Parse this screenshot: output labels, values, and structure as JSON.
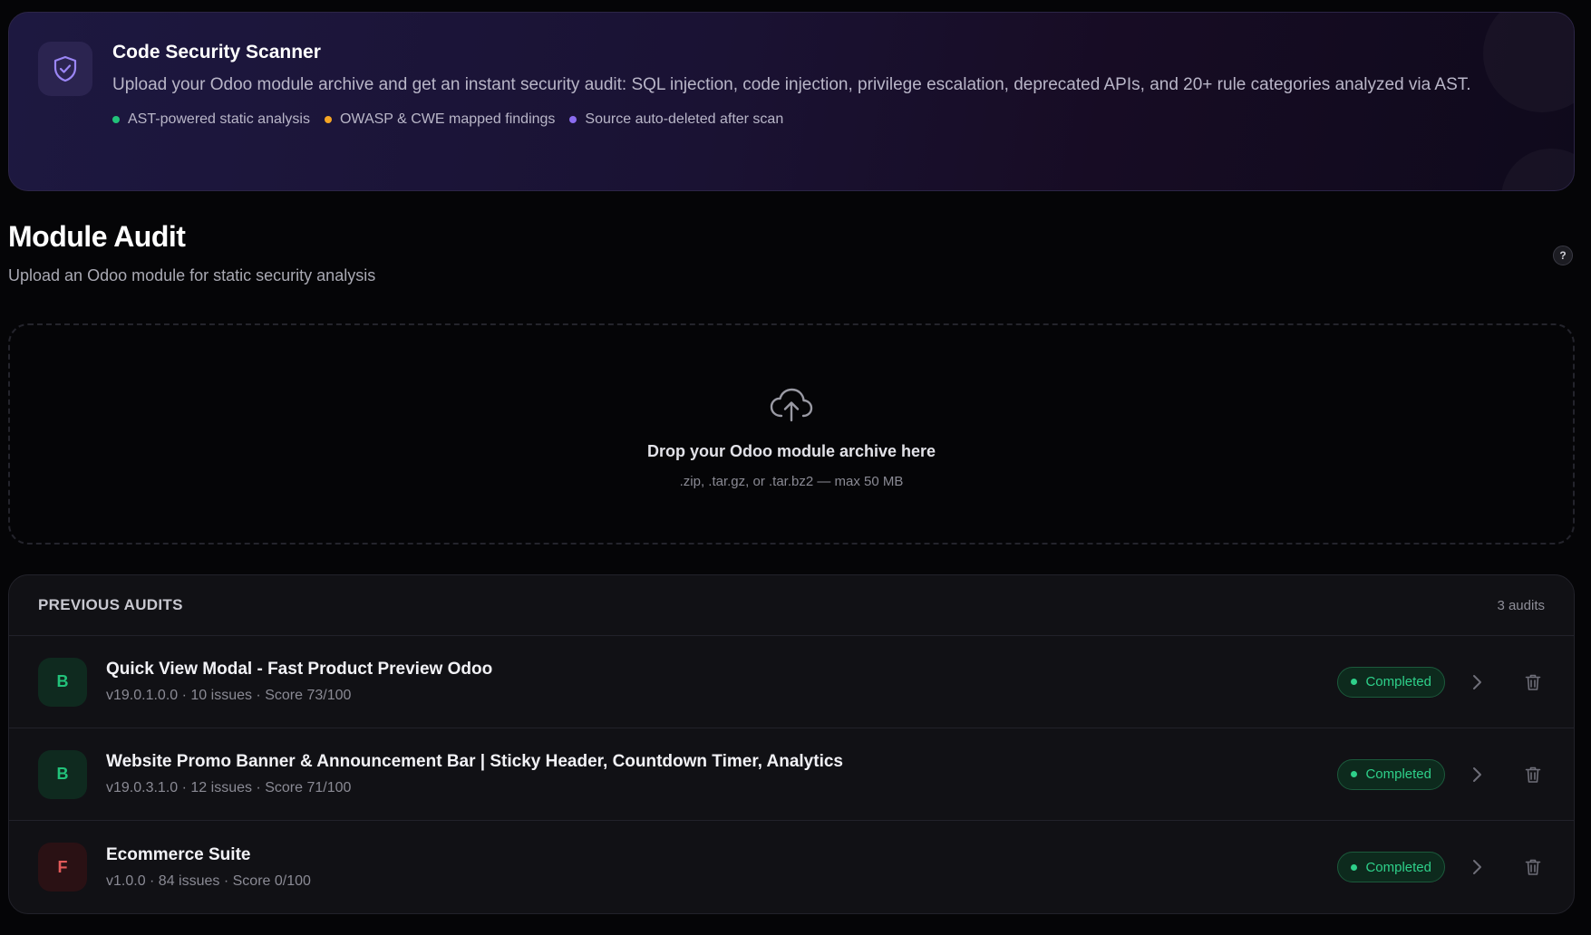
{
  "banner": {
    "title": "Code Security Scanner",
    "description": "Upload your Odoo module archive and get an instant security audit: SQL injection, code injection, privilege escalation, deprecated APIs, and 20+ rule categories analyzed via AST.",
    "icon": "shield-check-icon",
    "features": [
      {
        "label": "AST-powered static analysis",
        "color": "#22c27a"
      },
      {
        "label": "OWASP & CWE mapped findings",
        "color": "#f5a524"
      },
      {
        "label": "Source auto-deleted after scan",
        "color": "#8b6cf0"
      }
    ]
  },
  "header": {
    "title": "Module Audit",
    "subtitle": "Upload an Odoo module for static security analysis",
    "help_label": "?"
  },
  "dropzone": {
    "icon": "cloud-upload-icon",
    "title": "Drop your Odoo module archive here",
    "hint": ".zip, .tar.gz, or .tar.bz2 — max 50 MB"
  },
  "audits": {
    "title": "PREVIOUS AUDITS",
    "count": "3 audits",
    "items": [
      {
        "grade": "B",
        "name": "Quick View Modal - Fast Product Preview Odoo",
        "meta": "v19.0.1.0.0 · 10 issues · Score 73/100",
        "status": "Completed"
      },
      {
        "grade": "B",
        "name": "Website Promo Banner & Announcement Bar | Sticky Header, Countdown Timer, Analytics",
        "meta": "v19.0.3.1.0 · 12 issues · Score 71/100",
        "status": "Completed"
      },
      {
        "grade": "F",
        "name": "Ecommerce Suite",
        "meta": "v1.0.0 · 84 issues · Score 0/100",
        "status": "Completed"
      }
    ]
  },
  "colors": {
    "accent_success": "#2ed08a",
    "accent_fail": "#e25a5a",
    "banner_bg": "#1d1840"
  }
}
